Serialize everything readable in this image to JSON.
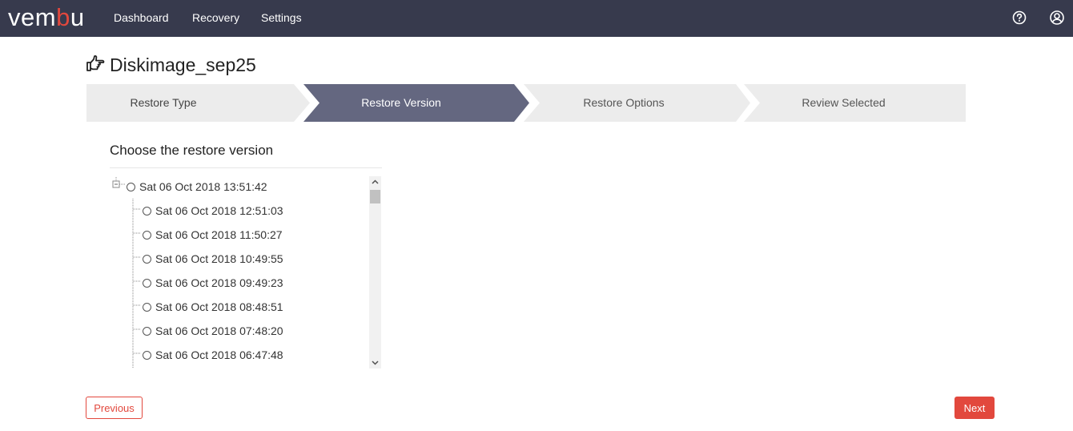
{
  "app": {
    "logo_prefix": "vem",
    "logo_accent": "b",
    "logo_suffix": "u",
    "brand_color": "#e2483d",
    "navbar_color": "#373a4d"
  },
  "nav": {
    "items": [
      {
        "label": "Dashboard"
      },
      {
        "label": "Recovery"
      },
      {
        "label": "Settings"
      }
    ],
    "help_icon": "help-circle-icon",
    "user_icon": "user-circle-icon"
  },
  "page": {
    "title": "Diskimage_sep25",
    "title_icon": "hand-pointing-icon"
  },
  "wizard": {
    "steps": [
      {
        "label": "Restore Type",
        "active": false
      },
      {
        "label": "Restore Version",
        "active": true
      },
      {
        "label": "Restore Options",
        "active": false
      },
      {
        "label": "Review Selected",
        "active": false
      }
    ],
    "active_color": "#646780",
    "inactive_color": "#ececec"
  },
  "restore": {
    "heading": "Choose the restore version",
    "parent": {
      "label": "Sat 06 Oct 2018 13:51:42",
      "expanded": true,
      "selected": false
    },
    "children": [
      {
        "label": "Sat 06 Oct 2018 12:51:03"
      },
      {
        "label": "Sat 06 Oct 2018 11:50:27"
      },
      {
        "label": "Sat 06 Oct 2018 10:49:55"
      },
      {
        "label": "Sat 06 Oct 2018 09:49:23"
      },
      {
        "label": "Sat 06 Oct 2018 08:48:51"
      },
      {
        "label": "Sat 06 Oct 2018 07:48:20"
      },
      {
        "label": "Sat 06 Oct 2018 06:47:48"
      }
    ]
  },
  "footer": {
    "previous_label": "Previous",
    "next_label": "Next"
  }
}
